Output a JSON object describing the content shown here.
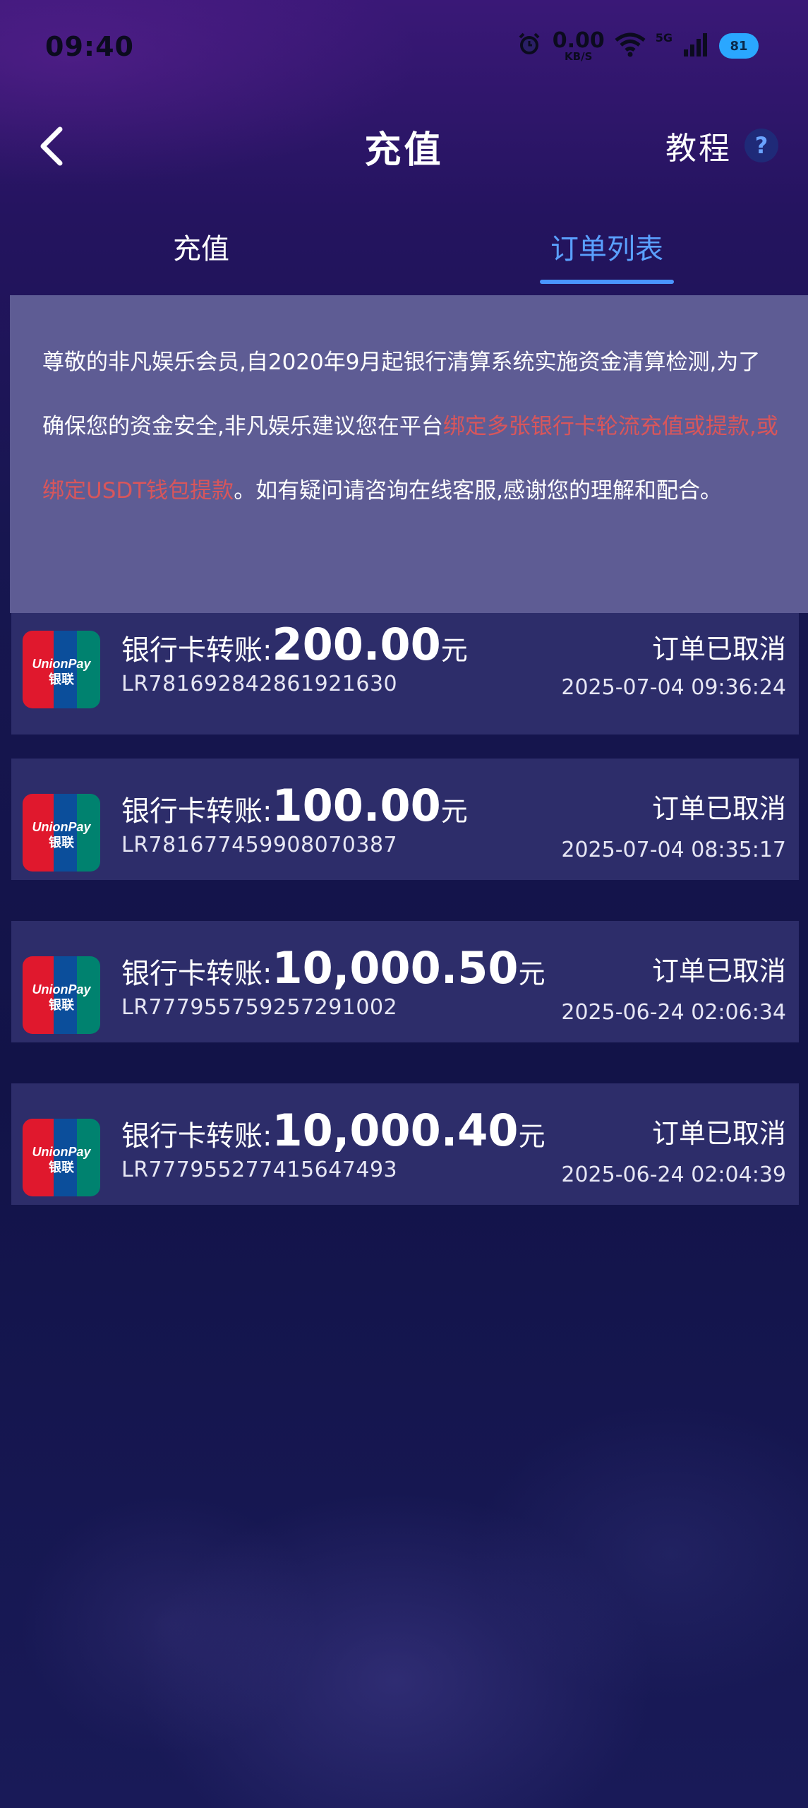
{
  "status_bar": {
    "time": "09:40",
    "net_speed": "0.00",
    "net_speed_unit": "KB/S",
    "network_type": "5G",
    "battery": "81"
  },
  "header": {
    "title": "充值",
    "tutorial_label": "教程",
    "help_symbol": "?"
  },
  "tabs": [
    {
      "label": "充值",
      "active": false
    },
    {
      "label": "订单列表",
      "active": true
    }
  ],
  "notice": {
    "text_before": "尊敬的非凡娱乐会员,自2020年9月起银行清算系统实施资金清算检测,为了确保您的资金安全,非凡娱乐建议您在平台",
    "text_highlight": "绑定多张银行卡轮流充值或提款,或绑定USDT钱包提款",
    "text_after": "。如有疑问请咨询在线客服,感谢您的理解和配合。",
    "highlight_color": "#d8565b"
  },
  "orders": [
    {
      "type": "银行卡转账:",
      "amount": "200.00",
      "unit": "元",
      "order_id": "LR781692842861921630",
      "status": "订单已取消",
      "time": "2025-07-04 09:36:24"
    },
    {
      "type": "银行卡转账:",
      "amount": "100.00",
      "unit": "元",
      "order_id": "LR781677459908070387",
      "status": "订单已取消",
      "time": "2025-07-04 08:35:17"
    },
    {
      "type": "银行卡转账:",
      "amount": "10,000.50",
      "unit": "元",
      "order_id": "LR777955759257291002",
      "status": "订单已取消",
      "time": "2025-06-24 02:06:34"
    },
    {
      "type": "银行卡转账:",
      "amount": "10,000.40",
      "unit": "元",
      "order_id": "LR777955277415647493",
      "status": "订单已取消",
      "time": "2025-06-24 02:04:39"
    }
  ],
  "logo": {
    "brand_text": "UnionPay",
    "brand_cn": "银联"
  },
  "colors": {
    "accent": "#4a95ff",
    "card_bg": "#2d2d6a",
    "notice_bg": "#5e5c94"
  }
}
